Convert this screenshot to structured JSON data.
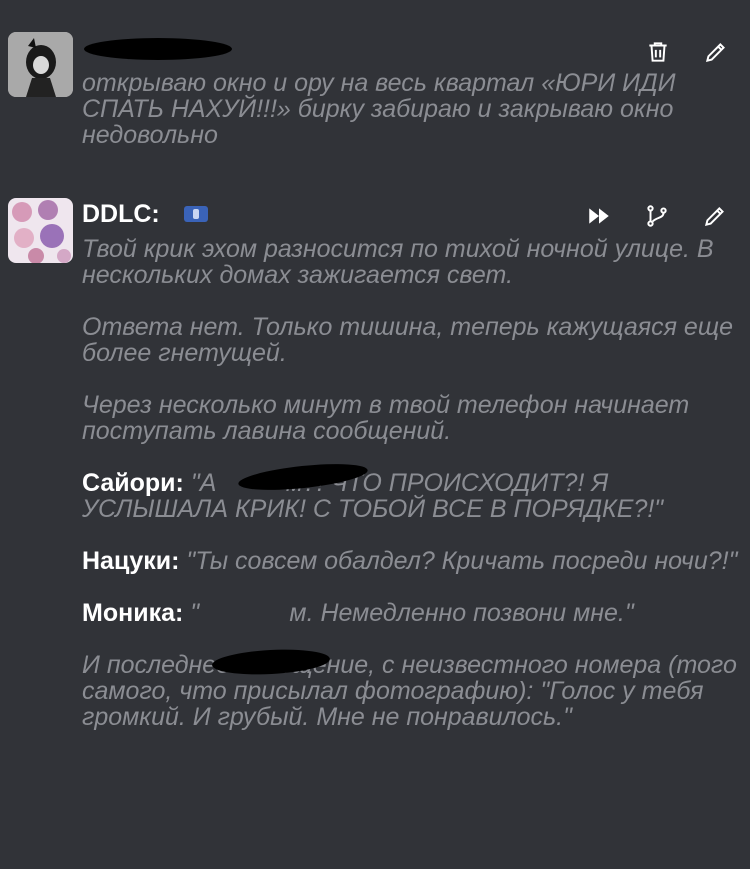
{
  "messages": [
    {
      "author": "",
      "text": "открываю окно и ору на весь квартал «ЮРИ ИДИ СПАТЬ НАХУЙ!!!» бирку забираю и закрываю окно недовольно",
      "actions": [
        "trash-icon",
        "pencil-icon"
      ]
    },
    {
      "author": "DDLC:",
      "actions": [
        "fast-forward-icon",
        "branch-icon",
        "pencil-icon"
      ],
      "paragraphs": [
        "Твой крик эхом разносится по тихой ночной улице. В нескольких домах зажигается свет.",
        "Ответа нет. Только тишина, теперь кажущаяся еще более гнетущей.",
        "Через несколько минут в твой телефон начинает поступать лавина сообщений."
      ],
      "dialogue": [
        {
          "speaker": "Сайори:",
          "line": " \"А          м?! ЧТО ПРОИСХОДИТ?! Я УСЛЫШАЛА КРИК! С ТОБОЙ ВСЕ В ПОРЯДКЕ?!\""
        },
        {
          "speaker": "Нацуки:",
          "line": " \"Ты совсем обалдел? Кричать посреди ночи?!\""
        },
        {
          "speaker": "Моника:",
          "line": " \"             м. Немедленно позвони мне.\""
        }
      ],
      "closing": "И последнее сообщение, с неизвестного номера (того самого, что присылал фотографию): \"Голос у тебя громкий. И грубый. Мне не понравилось.\""
    }
  ],
  "colors": {
    "background": "#313338",
    "muted_text": "#8b8d93",
    "name_text": "#ffffff"
  }
}
